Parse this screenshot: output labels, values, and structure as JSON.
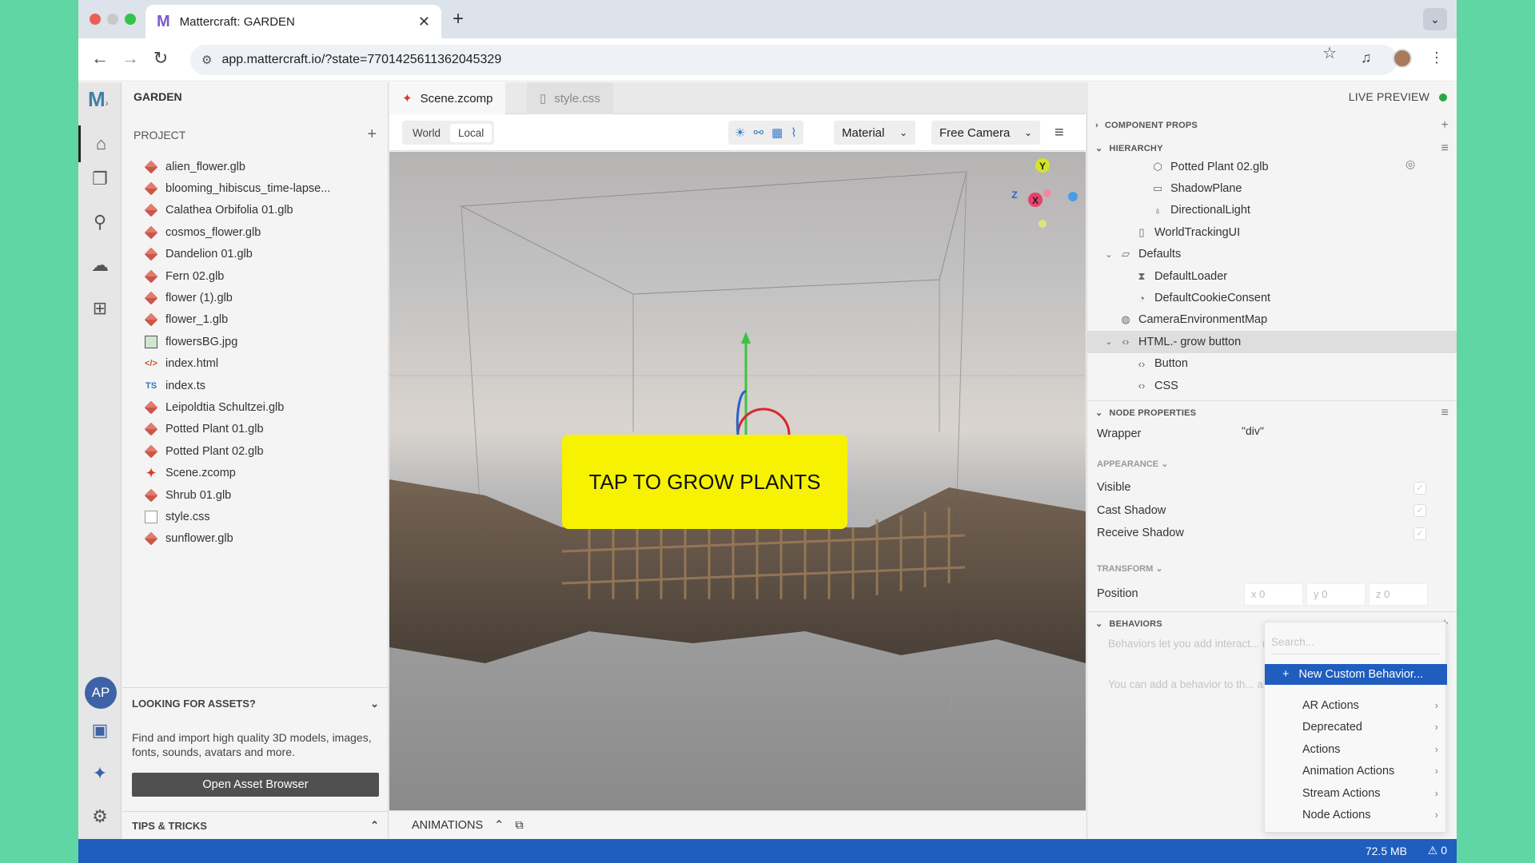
{
  "browser": {
    "tab_title": "Mattercraft: GARDEN",
    "favicon": "M",
    "url": "app.mattercraft.io/?state=7701425611362045329",
    "traffic_lights": [
      "#ec5f56",
      "#c9c9c9",
      "#36c24a"
    ]
  },
  "project": {
    "name": "GARDEN",
    "section_label": "PROJECT",
    "files": [
      {
        "name": "alien_flower.glb",
        "kind": "glb"
      },
      {
        "name": "blooming_hibiscus_time-lapse...",
        "kind": "glb"
      },
      {
        "name": "Calathea Orbifolia 01.glb",
        "kind": "glb"
      },
      {
        "name": "cosmos_flower.glb",
        "kind": "glb"
      },
      {
        "name": "Dandelion 01.glb",
        "kind": "glb"
      },
      {
        "name": "Fern 02.glb",
        "kind": "glb"
      },
      {
        "name": "flower (1).glb",
        "kind": "glb"
      },
      {
        "name": "flower_1.glb",
        "kind": "glb"
      },
      {
        "name": "flowersBG.jpg",
        "kind": "image"
      },
      {
        "name": "index.html",
        "kind": "html"
      },
      {
        "name": "index.ts",
        "kind": "ts"
      },
      {
        "name": "Leipoldtia Schultzei.glb",
        "kind": "glb"
      },
      {
        "name": "Potted Plant 01.glb",
        "kind": "glb"
      },
      {
        "name": "Potted Plant 02.glb",
        "kind": "glb"
      },
      {
        "name": "Scene.zcomp",
        "kind": "zcomp"
      },
      {
        "name": "Shrub 01.glb",
        "kind": "glb"
      },
      {
        "name": "style.css",
        "kind": "css"
      },
      {
        "name": "sunflower.glb",
        "kind": "glb"
      }
    ],
    "assets_title": "LOOKING FOR ASSETS?",
    "assets_desc": "Find and import high quality 3D models, images, fonts, sounds, avatars and more.",
    "assets_button": "Open Asset Browser",
    "tips_title": "TIPS & TRICKS",
    "user_initials": "AP",
    "icon_names": {
      "ts": "TS",
      "html": "</>"
    }
  },
  "editor": {
    "tabs": [
      {
        "label": "Scene.zcomp",
        "active": true
      },
      {
        "label": "style.css",
        "active": false
      }
    ],
    "space_toggle": [
      "World",
      "Local"
    ],
    "material_dropdown": "Material",
    "camera_dropdown": "Free Camera",
    "overlay_button_text": "TAP TO GROW PLANTS",
    "overlay_color": "#f6f200",
    "bottom_tab": "ANIMATIONS",
    "gizmo_labels": {
      "y": "Y",
      "z": "Z",
      "x": "X"
    }
  },
  "right": {
    "live_preview": "LIVE PREVIEW",
    "live_color": "#28a745",
    "component_props": "COMPONENT PROPS",
    "hierarchy_title": "HIERARCHY",
    "hierarchy": [
      {
        "label": "Potted Plant 02.glb",
        "icon": "mesh-icon",
        "depth": 3,
        "expanded": null
      },
      {
        "label": "ShadowPlane",
        "icon": "plane-icon",
        "depth": 3,
        "expanded": null
      },
      {
        "label": "DirectionalLight",
        "icon": "light-icon",
        "depth": 3,
        "expanded": null
      },
      {
        "label": "WorldTrackingUI",
        "icon": "device-icon",
        "depth": 2,
        "expanded": null
      },
      {
        "label": "Defaults",
        "icon": "folder-icon",
        "depth": 1,
        "expanded": true
      },
      {
        "label": "DefaultLoader",
        "icon": "hourglass-icon",
        "depth": 2,
        "expanded": null
      },
      {
        "label": "DefaultCookieConsent",
        "icon": "cookie-icon",
        "depth": 2,
        "expanded": null
      },
      {
        "label": "CameraEnvironmentMap",
        "icon": "globe-icon",
        "depth": 1,
        "expanded": null
      },
      {
        "label": "HTML.- grow button",
        "icon": "code-icon",
        "depth": 1,
        "expanded": true,
        "selected": true
      },
      {
        "label": "Button",
        "icon": "code-icon",
        "depth": 2,
        "expanded": null
      },
      {
        "label": "CSS",
        "icon": "code-icon",
        "depth": 2,
        "expanded": null
      }
    ],
    "node_properties": "NODE PROPERTIES",
    "wrapper_label": "Wrapper",
    "wrapper_value": "\"div\"",
    "appearance_title": "APPEARANCE",
    "visible_label": "Visible",
    "cast_shadow_label": "Cast Shadow",
    "receive_shadow_label": "Receive Shadow",
    "transform_title": "TRANSFORM",
    "position_label": "Position",
    "position": {
      "x": "0",
      "y": "0",
      "z": "0"
    },
    "axis_letters": {
      "x": "x",
      "y": "y",
      "z": "z"
    },
    "behaviors_title": "BEHAVIORS",
    "behaviors_help_1": "Behaviors let you add interact... nodes.",
    "behaviors_help_2": "You can add a behavior to th... above."
  },
  "behavior_menu": {
    "search_placeholder": "Search...",
    "new_custom": "New Custom Behavior...",
    "items": [
      "AR Actions",
      "Deprecated",
      "Actions",
      "Animation Actions",
      "Stream Actions",
      "Node Actions"
    ]
  },
  "status": {
    "memory": "72.5 MB",
    "warnings": "0"
  }
}
